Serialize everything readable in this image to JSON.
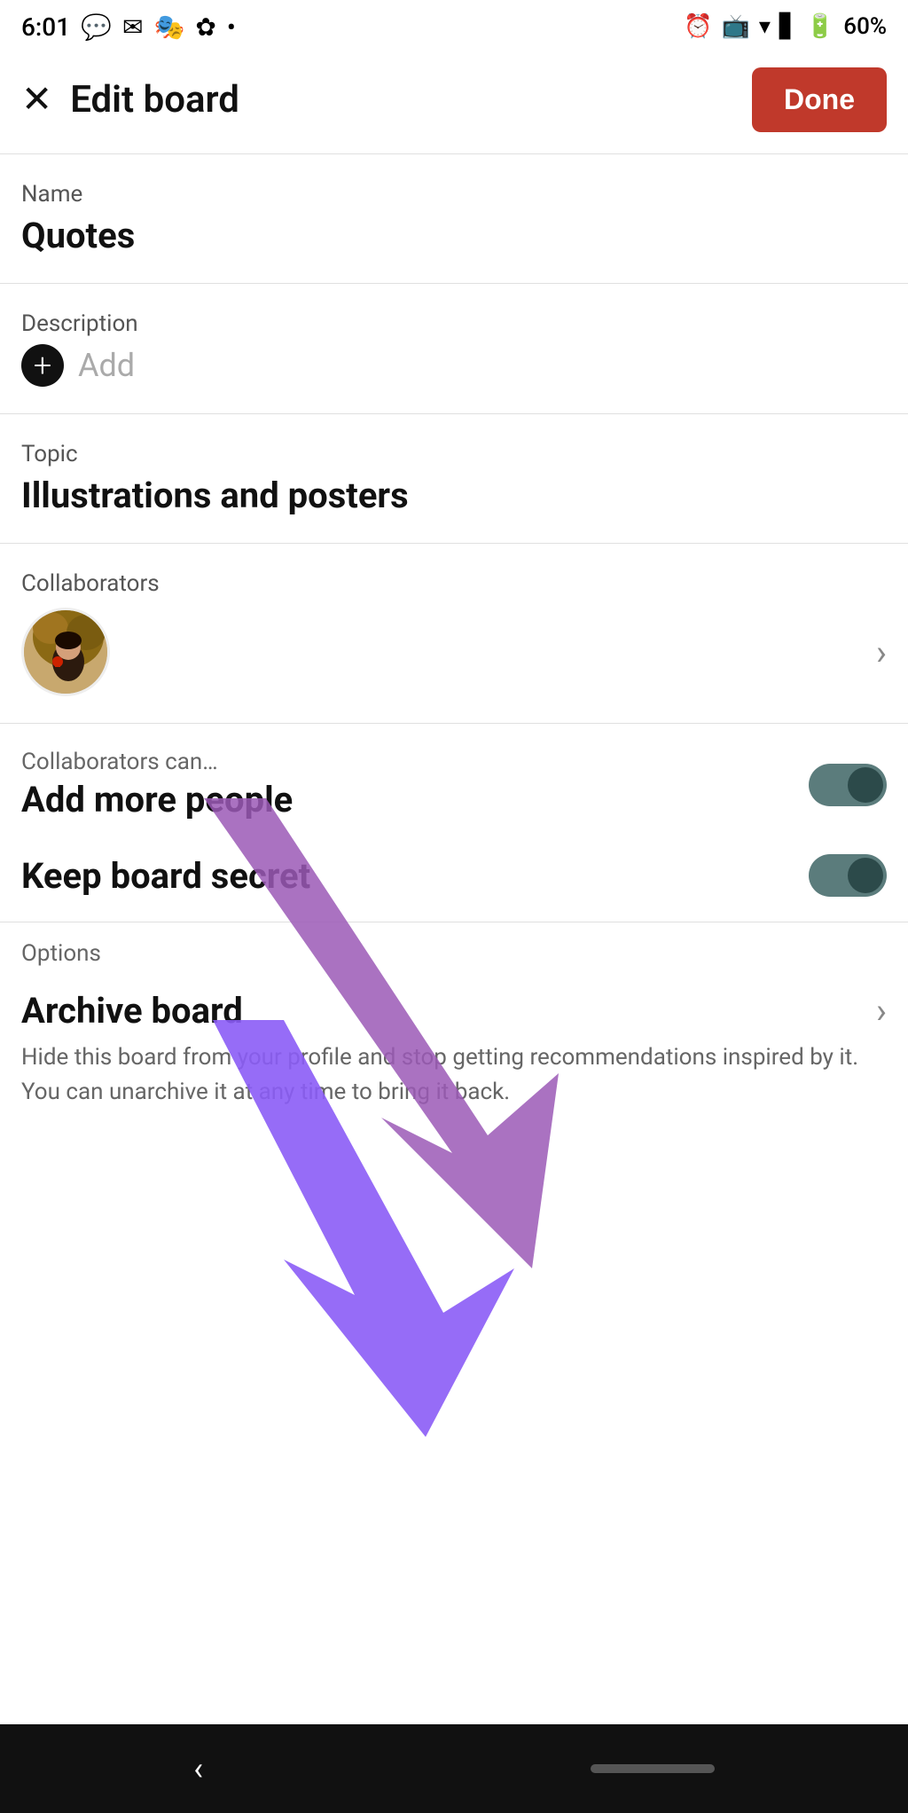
{
  "statusBar": {
    "time": "6:01",
    "battery": "60%"
  },
  "header": {
    "title": "Edit board",
    "doneLabel": "Done"
  },
  "name": {
    "label": "Name",
    "value": "Quotes"
  },
  "description": {
    "label": "Description",
    "addText": "Add"
  },
  "topic": {
    "label": "Topic",
    "value": "Illustrations and posters"
  },
  "collaborators": {
    "label": "Collaborators"
  },
  "addMorePeople": {
    "sublabel": "Collaborators can…",
    "label": "Add more people"
  },
  "keepBoardSecret": {
    "label": "Keep board secret"
  },
  "options": {
    "label": "Options",
    "archiveTitle": "Archive board",
    "archiveDescription": "Hide this board from your profile and stop getting recommendations inspired by it. You can unarchive it at any time to bring it back."
  },
  "icons": {
    "close": "✕",
    "chevronRight": "›",
    "plusCircle": "+",
    "navBack": "‹"
  },
  "colors": {
    "doneButton": "#c0392b",
    "toggleOn": "#5b8080",
    "toggleKnob": "#2c4a4a"
  }
}
